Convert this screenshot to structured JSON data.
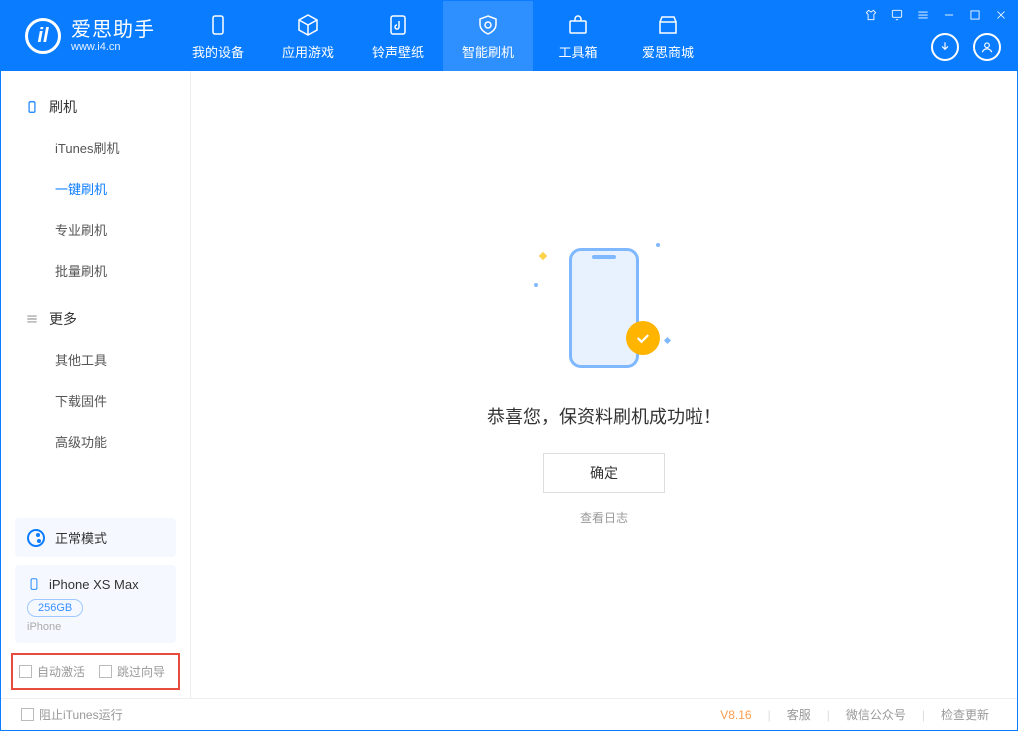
{
  "app": {
    "title": "爱思助手",
    "subtitle": "www.i4.cn"
  },
  "tabs": [
    {
      "label": "我的设备"
    },
    {
      "label": "应用游戏"
    },
    {
      "label": "铃声壁纸"
    },
    {
      "label": "智能刷机"
    },
    {
      "label": "工具箱"
    },
    {
      "label": "爱思商城"
    }
  ],
  "sidebar": {
    "section1_title": "刷机",
    "items1": [
      {
        "label": "iTunes刷机"
      },
      {
        "label": "一键刷机"
      },
      {
        "label": "专业刷机"
      },
      {
        "label": "批量刷机"
      }
    ],
    "section2_title": "更多",
    "items2": [
      {
        "label": "其他工具"
      },
      {
        "label": "下载固件"
      },
      {
        "label": "高级功能"
      }
    ],
    "mode_label": "正常模式",
    "device": {
      "name": "iPhone XS Max",
      "capacity": "256GB",
      "type": "iPhone"
    },
    "checkbox1": "自动激活",
    "checkbox2": "跳过向导"
  },
  "main": {
    "success_text": "恭喜您，保资料刷机成功啦！",
    "ok_button": "确定",
    "view_log": "查看日志"
  },
  "footer": {
    "block_itunes": "阻止iTunes运行",
    "version": "V8.16",
    "link1": "客服",
    "link2": "微信公众号",
    "link3": "检查更新"
  }
}
